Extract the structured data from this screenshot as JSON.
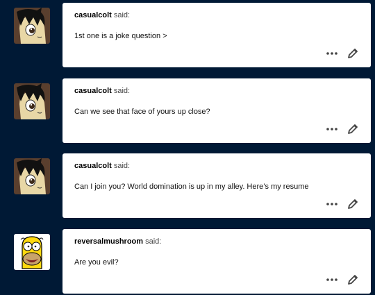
{
  "posts": [
    {
      "author": "casualcolt",
      "said": "said:",
      "message": "1st one is a joke question >",
      "avatar_icon": "pony-avatar-icon"
    },
    {
      "author": "casualcolt",
      "said": "said:",
      "message": "Can we see that face of yours up close?",
      "avatar_icon": "pony-avatar-icon"
    },
    {
      "author": "casualcolt",
      "said": "said:",
      "message": "Can I join you? World domination is up in my alley. Here’s my resume",
      "avatar_icon": "pony-avatar-icon"
    },
    {
      "author": "reversalmushroom",
      "said": "said:",
      "message": "Are you evil?",
      "avatar_icon": "homer-avatar-icon"
    }
  ],
  "colors": {
    "background": "#001935",
    "card": "#ffffff",
    "icon": "#444444"
  }
}
